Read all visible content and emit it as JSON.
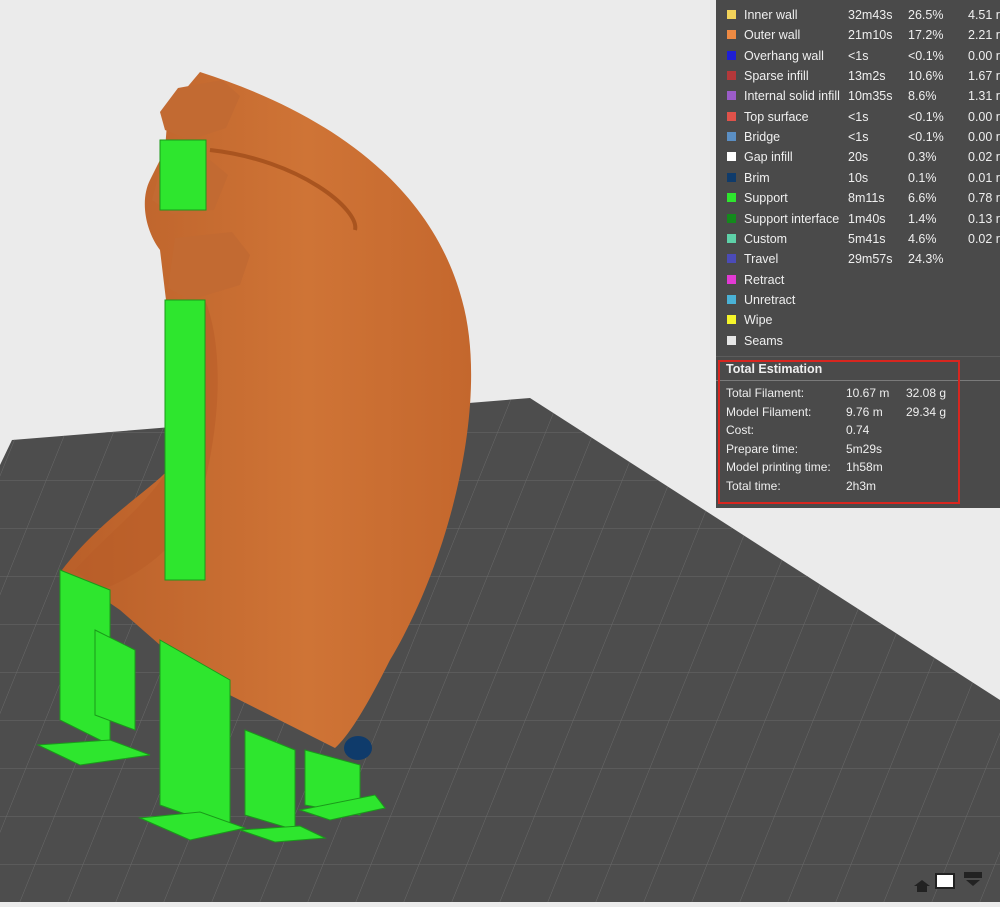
{
  "legend": {
    "items": [
      {
        "label": "Inner wall",
        "time": "32m43s",
        "percent": "26.5%",
        "filament": "4.51 r",
        "color": "#f2d35a"
      },
      {
        "label": "Outer wall",
        "time": "21m10s",
        "percent": "17.2%",
        "filament": "2.21 r",
        "color": "#ee8a43"
      },
      {
        "label": "Overhang wall",
        "time": "<1s",
        "percent": "<0.1%",
        "filament": "0.00 r",
        "color": "#1f1fd6"
      },
      {
        "label": "Sparse infill",
        "time": "13m2s",
        "percent": "10.6%",
        "filament": "1.67 r",
        "color": "#b4383a"
      },
      {
        "label": "Internal solid infill",
        "time": "10m35s",
        "percent": "8.6%",
        "filament": "1.31 r",
        "color": "#9b5cc9"
      },
      {
        "label": "Top surface",
        "time": "<1s",
        "percent": "<0.1%",
        "filament": "0.00 r",
        "color": "#e0524a"
      },
      {
        "label": "Bridge",
        "time": "<1s",
        "percent": "<0.1%",
        "filament": "0.00 r",
        "color": "#5b8fc4"
      },
      {
        "label": "Gap infill",
        "time": "20s",
        "percent": "0.3%",
        "filament": "0.02 r",
        "color": "#ffffff"
      },
      {
        "label": "Brim",
        "time": "10s",
        "percent": "0.1%",
        "filament": "0.01 r",
        "color": "#0f3b6b"
      },
      {
        "label": "Support",
        "time": "8m11s",
        "percent": "6.6%",
        "filament": "0.78 r",
        "color": "#2ee62e"
      },
      {
        "label": "Support interface",
        "time": "1m40s",
        "percent": "1.4%",
        "filament": "0.13 r",
        "color": "#138a1c"
      },
      {
        "label": "Custom",
        "time": "5m41s",
        "percent": "4.6%",
        "filament": "0.02 r",
        "color": "#5ed1a8"
      },
      {
        "label": "Travel",
        "time": "29m57s",
        "percent": "24.3%",
        "filament": "",
        "color": "#4b4bb8"
      },
      {
        "label": "Retract",
        "time": "",
        "percent": "",
        "filament": "",
        "color": "#e23ad4"
      },
      {
        "label": "Unretract",
        "time": "",
        "percent": "",
        "filament": "",
        "color": "#4ab2d6"
      },
      {
        "label": "Wipe",
        "time": "",
        "percent": "",
        "filament": "",
        "color": "#f5f52a"
      },
      {
        "label": "Seams",
        "time": "",
        "percent": "",
        "filament": "",
        "color": "#e6e6e6"
      }
    ]
  },
  "estimation": {
    "title": "Total Estimation",
    "rows": [
      {
        "label": "Total Filament:",
        "v1": "10.67 m",
        "v2": "32.08 g"
      },
      {
        "label": "Model Filament:",
        "v1": "9.76 m",
        "v2": "29.34 g"
      },
      {
        "label": "Cost:",
        "v1": "0.74",
        "v2": ""
      },
      {
        "label": "Prepare time:",
        "v1": "5m29s",
        "v2": ""
      },
      {
        "label": "Model printing time:",
        "v1": "1h58m",
        "v2": ""
      },
      {
        "label": "Total time:",
        "v1": "2h3m",
        "v2": ""
      }
    ]
  },
  "viewport": {
    "background_color": "#ebebeb",
    "bed_color": "#4d4d4d",
    "model_color": "#c86b32",
    "support_color": "#2ee62e",
    "highlight_color": "#d8261f"
  },
  "controls": {
    "icons": [
      "layer-up-icon",
      "view-cube-icon",
      "layer-down-icon"
    ]
  }
}
